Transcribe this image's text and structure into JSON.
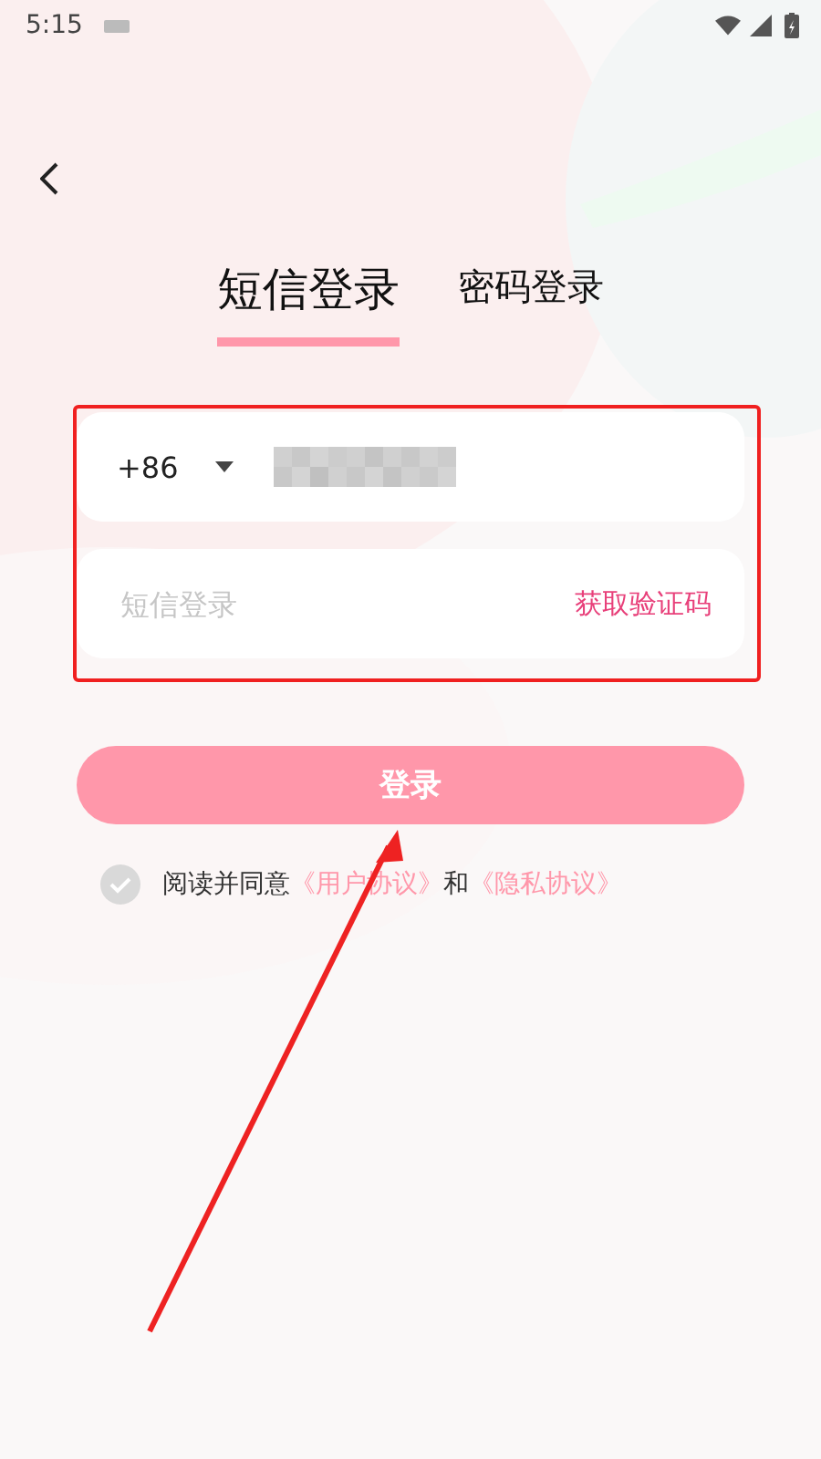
{
  "status_bar": {
    "time": "5:15"
  },
  "tabs": [
    {
      "label": "短信登录",
      "selected": true
    },
    {
      "label": "密码登录",
      "selected": false
    }
  ],
  "phone_field": {
    "country_code": "+86"
  },
  "code_field": {
    "placeholder": "短信登录",
    "action": "获取验证码"
  },
  "login_button": {
    "label": "登录",
    "disabled": true
  },
  "agreement": {
    "checked": false,
    "prefix": "阅读并同意",
    "links": [
      "《用户协议》",
      "《隐私协议》"
    ],
    "joiner": "和"
  }
}
